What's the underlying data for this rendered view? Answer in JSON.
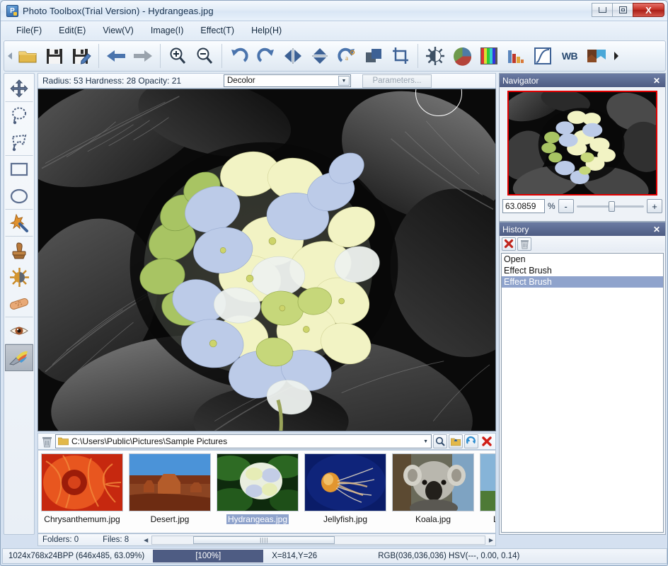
{
  "window": {
    "title": "Photo Toolbox(Trial Version) - Hydrangeas.jpg",
    "app_icon": "app-logo-icon",
    "minimize_label": "Minimize",
    "maximize_label": "Maximize",
    "close_label": "X"
  },
  "menu": {
    "items": [
      {
        "label": "File(F)"
      },
      {
        "label": "Edit(E)"
      },
      {
        "label": "View(V)"
      },
      {
        "label": "Image(I)"
      },
      {
        "label": "Effect(T)"
      },
      {
        "label": "Help(H)"
      }
    ]
  },
  "toolbar": {
    "overflow_left": "chevron-left-icon",
    "overflow_right": "chevron-right-icon",
    "buttons": [
      {
        "name": "open-folder-icon",
        "tip": "Open"
      },
      {
        "name": "save-icon",
        "tip": "Save"
      },
      {
        "name": "save-as-icon",
        "tip": "Save As"
      },
      {
        "name": "previous-image-icon",
        "tip": "Previous"
      },
      {
        "name": "next-image-icon",
        "tip": "Next"
      },
      {
        "name": "zoom-in-icon",
        "tip": "Zoom In"
      },
      {
        "name": "zoom-out-icon",
        "tip": "Zoom Out"
      },
      {
        "name": "rotate-left-icon",
        "tip": "Rotate Left"
      },
      {
        "name": "rotate-right-icon",
        "tip": "Rotate Right"
      },
      {
        "name": "flip-horizontal-icon",
        "tip": "Flip Horizontal"
      },
      {
        "name": "flip-vertical-icon",
        "tip": "Flip Vertical"
      },
      {
        "name": "free-rotate-icon",
        "tip": "Free Rotate"
      },
      {
        "name": "canvas-size-icon",
        "tip": "Canvas Size"
      },
      {
        "name": "crop-icon",
        "tip": "Crop"
      },
      {
        "name": "brightness-contrast-icon",
        "tip": "Brightness / Contrast"
      },
      {
        "name": "color-balance-icon",
        "tip": "Color Balance"
      },
      {
        "name": "hue-saturation-icon",
        "tip": "Hue / Saturation"
      },
      {
        "name": "levels-icon",
        "tip": "Levels"
      },
      {
        "name": "curves-icon",
        "tip": "Curves"
      },
      {
        "name": "white-balance-icon",
        "tip": "WB"
      },
      {
        "name": "auto-enhance-icon",
        "tip": "Auto Enhance"
      }
    ],
    "white_balance_label": "WB"
  },
  "tools": {
    "items": [
      {
        "name": "move-tool",
        "label": "Move"
      },
      {
        "name": "lasso-select-tool",
        "label": "Lasso Select"
      },
      {
        "name": "polygon-select-tool",
        "label": "Polygon Select"
      },
      {
        "name": "rectangle-select-tool",
        "label": "Rectangle Select"
      },
      {
        "name": "ellipse-select-tool",
        "label": "Ellipse Select"
      },
      {
        "name": "magic-wand-tool",
        "label": "Magic Wand"
      },
      {
        "name": "clone-stamp-tool",
        "label": "Clone Stamp"
      },
      {
        "name": "dodge-burn-tool",
        "label": "Dodge / Burn"
      },
      {
        "name": "healing-brush-tool",
        "label": "Healing Brush"
      },
      {
        "name": "red-eye-tool",
        "label": "Red Eye Removal"
      },
      {
        "name": "effect-brush-tool",
        "label": "Effect Brush",
        "active": true
      }
    ]
  },
  "options_bar": {
    "settings_text": "Radius: 53 Hardness: 28 Opacity: 21",
    "radius_label": "Radius:",
    "radius_value": "53",
    "hardness_label": "Hardness:",
    "hardness_value": "28",
    "opacity_label": "Opacity:",
    "opacity_value": "21",
    "effect_selected": "Decolor",
    "effect_options": [
      "Decolor"
    ],
    "parameters_button": "Parameters..."
  },
  "canvas": {
    "image_name": "Hydrangeas.jpg",
    "brush_cursor": "brush-circle-cursor"
  },
  "path_bar": {
    "trash_icon": "trash-icon",
    "folder_icon": "folder-icon",
    "path": "C:\\Users\\Public\\Pictures\\Sample Pictures",
    "dropdown_icon": "chevron-down-icon",
    "search_icon": "search-icon",
    "up_icon": "go-up-folder-icon",
    "refresh_icon": "refresh-icon",
    "delete_icon": "delete-red-x-icon"
  },
  "filmstrip": {
    "thumbnails": [
      {
        "label": "Chrysanthemum.jpg",
        "selected": false,
        "kind": "chrysanthemum"
      },
      {
        "label": "Desert.jpg",
        "selected": false,
        "kind": "desert"
      },
      {
        "label": "Hydrangeas.jpg",
        "selected": true,
        "kind": "hydrangeas"
      },
      {
        "label": "Jellyfish.jpg",
        "selected": false,
        "kind": "jellyfish"
      },
      {
        "label": "Koala.jpg",
        "selected": false,
        "kind": "koala"
      },
      {
        "label": "Lighthouse.jpg",
        "selected": false,
        "kind": "lighthouse"
      }
    ],
    "folders_label": "Folders: 0",
    "files_label": "Files: 8",
    "scroll_left_icon": "scroll-left-icon",
    "scroll_right_icon": "scroll-right-icon",
    "scroll_grip": "||||"
  },
  "navigator": {
    "title": "Navigator",
    "close_icon": "close-icon",
    "zoom_value": "63.0859",
    "percent_label": "%",
    "zoom_out_label": "-",
    "zoom_in_label": "+",
    "view_border_color": "#e40000"
  },
  "history": {
    "title": "History",
    "close_icon": "close-icon",
    "clear_icon": "red-x-icon",
    "delete_icon": "trash-icon",
    "items": [
      {
        "label": "Open",
        "selected": false
      },
      {
        "label": "Effect Brush",
        "selected": false
      },
      {
        "label": "Effect Brush",
        "selected": true
      }
    ]
  },
  "status_bar": {
    "image_info": "1024x768x24BPP (646x485, 63.09%)",
    "zoom": "[100%]",
    "coordinates": "X=814,Y=26",
    "color_info": "RGB(036,036,036) HSV(---, 0.00, 0.14)"
  },
  "colors": {
    "panel_title": "#4e5c83",
    "selection": "#8fa3cc",
    "accent_red": "#e40000",
    "close_button": "#c32f24"
  }
}
